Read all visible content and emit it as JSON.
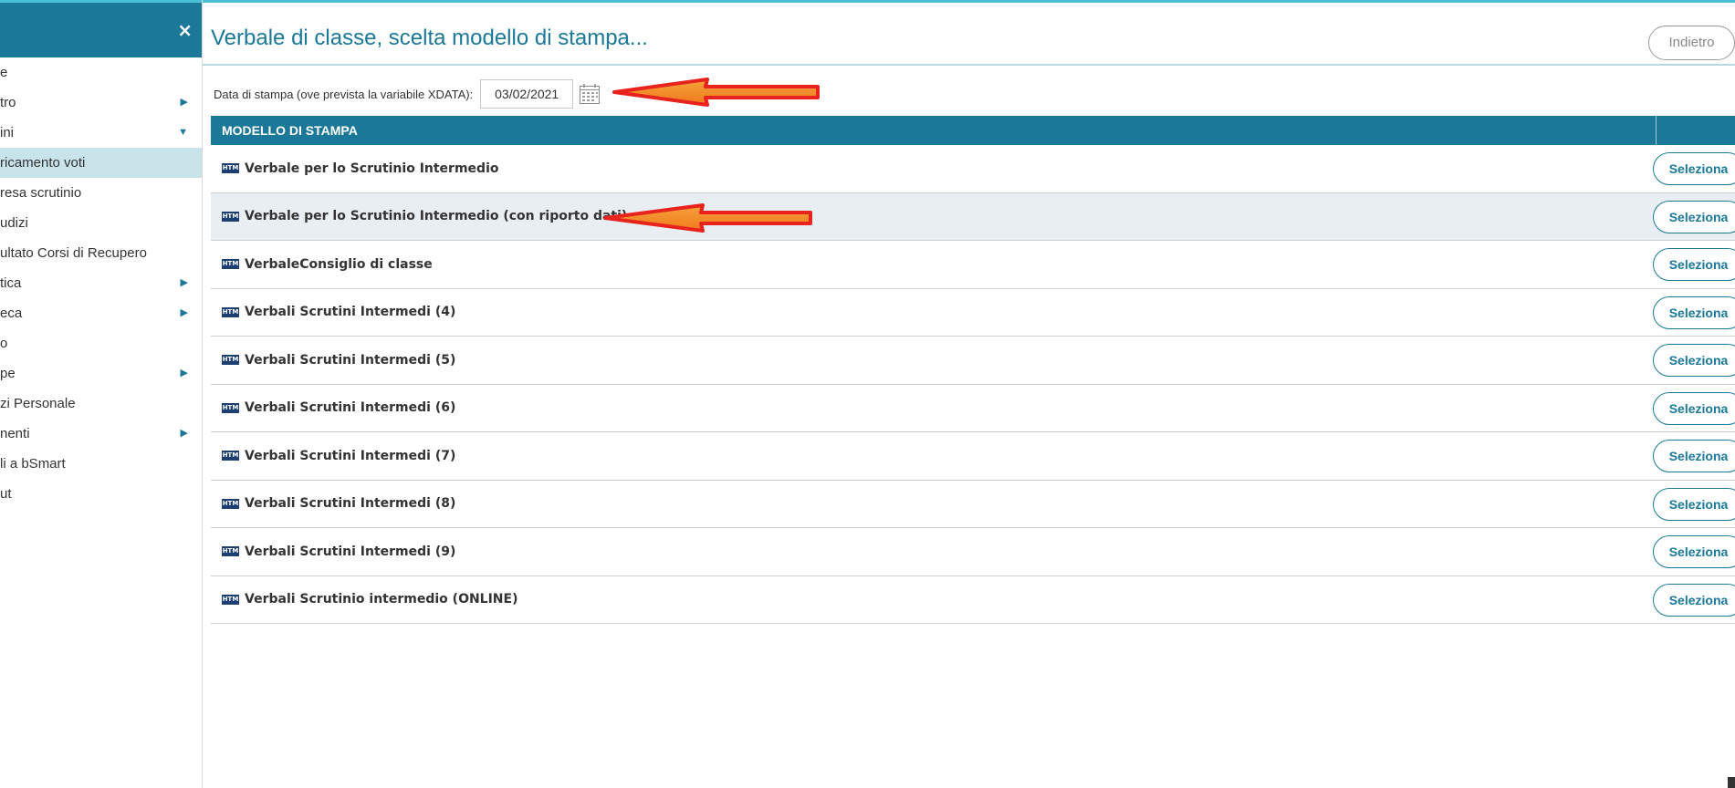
{
  "sidebar": {
    "close_icon": "×",
    "items": [
      {
        "label": "e",
        "caret": ""
      },
      {
        "label": "tro",
        "caret": "▶"
      },
      {
        "label": "ini",
        "caret": "▼"
      },
      {
        "label": "ricamento voti",
        "caret": "",
        "active": true
      },
      {
        "label": "resa scrutinio",
        "caret": ""
      },
      {
        "label": "udizi",
        "caret": ""
      },
      {
        "label": "ultato Corsi di Recupero",
        "caret": ""
      },
      {
        "label": "tica",
        "caret": "▶"
      },
      {
        "label": "eca",
        "caret": "▶"
      },
      {
        "label": "o",
        "caret": ""
      },
      {
        "label": "pe",
        "caret": "▶"
      },
      {
        "label": "zi Personale",
        "caret": ""
      },
      {
        "label": "nenti",
        "caret": "▶"
      },
      {
        "label": "li a bSmart",
        "caret": ""
      },
      {
        "label": "ut",
        "caret": ""
      }
    ]
  },
  "header": {
    "title": "Verbale di classe, scelta modello di stampa...",
    "back_label": "Indietro"
  },
  "date_row": {
    "label": "Data di stampa (ove prevista la variabile XDATA):",
    "value": "03/02/2021"
  },
  "table": {
    "header": "MODELLO DI STAMPA",
    "icon_text": "HTM",
    "select_label": "Seleziona",
    "rows": [
      "Verbale per lo Scrutinio Intermedio",
      "Verbale per lo Scrutinio Intermedio (con riporto dati)",
      "VerbaleConsiglio di classe",
      "Verbali Scrutini Intermedi (4)",
      "Verbali Scrutini Intermedi (5)",
      "Verbali Scrutini Intermedi (6)",
      "Verbali Scrutini Intermedi (7)",
      "Verbali Scrutini Intermedi (8)",
      "Verbali Scrutini Intermedi (9)",
      "Verbali Scrutinio intermedio (ONLINE)"
    ],
    "highlighted_row": 1
  },
  "colors": {
    "primary": "#1b7898",
    "accent_line": "#49c0d6",
    "active_item": "#c8e4ea",
    "annotation_arrow": "#e8231e"
  }
}
